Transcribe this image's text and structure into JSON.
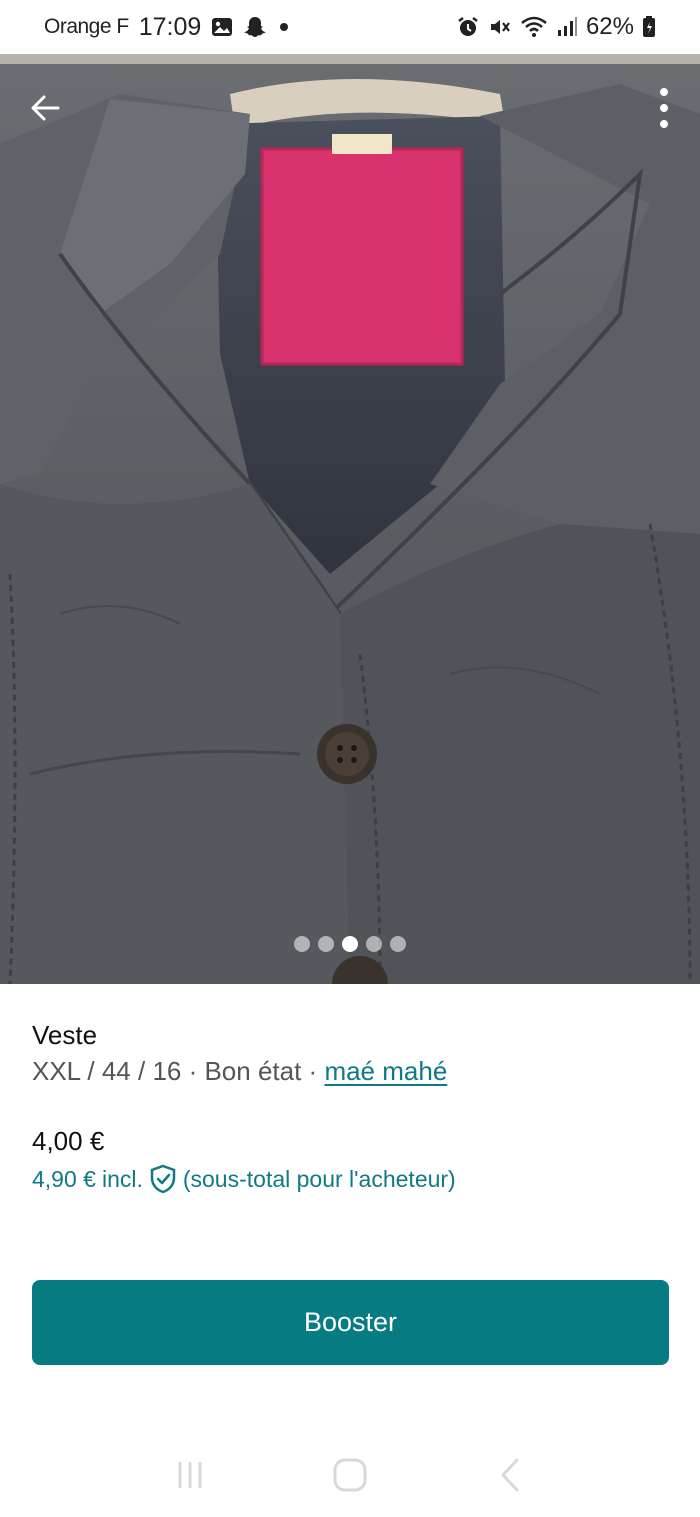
{
  "status_bar": {
    "carrier": "Orange F",
    "time": "17:09",
    "battery": "62%",
    "icons_left": [
      "gallery-icon",
      "snapchat-icon",
      "dot-icon"
    ],
    "icons_right": [
      "alarm-icon",
      "mute-icon",
      "wifi-icon",
      "signal-icon",
      "battery-icon"
    ]
  },
  "photo": {
    "dots_total": 5,
    "dots_active_index": 2,
    "colors": {
      "fabric": "#5a5d61",
      "label": "#d9336e",
      "lining": "#3e4450"
    }
  },
  "item": {
    "title": "Veste",
    "meta_prefix": "XXL / 44 / 16 · Bon état · ",
    "brand": "maé mahé",
    "price": "4,00 €",
    "buyer_price": "4,90 €",
    "buyer_incl": "incl.",
    "buyer_note": "(sous-total pour l'acheteur)"
  },
  "actions": {
    "booster_label": "Booster"
  },
  "colors": {
    "accent": "#077b82",
    "link": "#0f7a86"
  }
}
